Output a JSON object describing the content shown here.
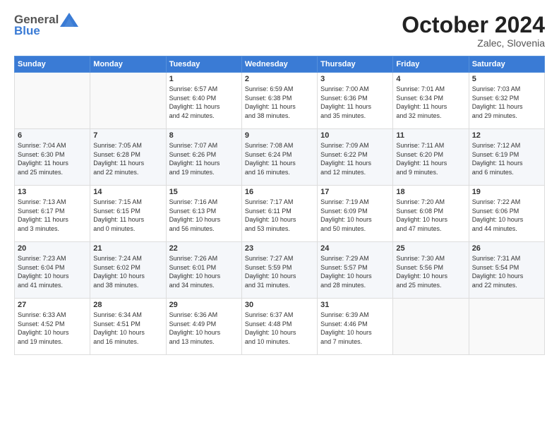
{
  "header": {
    "logo_general": "General",
    "logo_blue": "Blue",
    "month_year": "October 2024",
    "location": "Zalec, Slovenia"
  },
  "days_of_week": [
    "Sunday",
    "Monday",
    "Tuesday",
    "Wednesday",
    "Thursday",
    "Friday",
    "Saturday"
  ],
  "weeks": [
    [
      {
        "day": "",
        "info": ""
      },
      {
        "day": "",
        "info": ""
      },
      {
        "day": "1",
        "info": "Sunrise: 6:57 AM\nSunset: 6:40 PM\nDaylight: 11 hours\nand 42 minutes."
      },
      {
        "day": "2",
        "info": "Sunrise: 6:59 AM\nSunset: 6:38 PM\nDaylight: 11 hours\nand 38 minutes."
      },
      {
        "day": "3",
        "info": "Sunrise: 7:00 AM\nSunset: 6:36 PM\nDaylight: 11 hours\nand 35 minutes."
      },
      {
        "day": "4",
        "info": "Sunrise: 7:01 AM\nSunset: 6:34 PM\nDaylight: 11 hours\nand 32 minutes."
      },
      {
        "day": "5",
        "info": "Sunrise: 7:03 AM\nSunset: 6:32 PM\nDaylight: 11 hours\nand 29 minutes."
      }
    ],
    [
      {
        "day": "6",
        "info": "Sunrise: 7:04 AM\nSunset: 6:30 PM\nDaylight: 11 hours\nand 25 minutes."
      },
      {
        "day": "7",
        "info": "Sunrise: 7:05 AM\nSunset: 6:28 PM\nDaylight: 11 hours\nand 22 minutes."
      },
      {
        "day": "8",
        "info": "Sunrise: 7:07 AM\nSunset: 6:26 PM\nDaylight: 11 hours\nand 19 minutes."
      },
      {
        "day": "9",
        "info": "Sunrise: 7:08 AM\nSunset: 6:24 PM\nDaylight: 11 hours\nand 16 minutes."
      },
      {
        "day": "10",
        "info": "Sunrise: 7:09 AM\nSunset: 6:22 PM\nDaylight: 11 hours\nand 12 minutes."
      },
      {
        "day": "11",
        "info": "Sunrise: 7:11 AM\nSunset: 6:20 PM\nDaylight: 11 hours\nand 9 minutes."
      },
      {
        "day": "12",
        "info": "Sunrise: 7:12 AM\nSunset: 6:19 PM\nDaylight: 11 hours\nand 6 minutes."
      }
    ],
    [
      {
        "day": "13",
        "info": "Sunrise: 7:13 AM\nSunset: 6:17 PM\nDaylight: 11 hours\nand 3 minutes."
      },
      {
        "day": "14",
        "info": "Sunrise: 7:15 AM\nSunset: 6:15 PM\nDaylight: 11 hours\nand 0 minutes."
      },
      {
        "day": "15",
        "info": "Sunrise: 7:16 AM\nSunset: 6:13 PM\nDaylight: 10 hours\nand 56 minutes."
      },
      {
        "day": "16",
        "info": "Sunrise: 7:17 AM\nSunset: 6:11 PM\nDaylight: 10 hours\nand 53 minutes."
      },
      {
        "day": "17",
        "info": "Sunrise: 7:19 AM\nSunset: 6:09 PM\nDaylight: 10 hours\nand 50 minutes."
      },
      {
        "day": "18",
        "info": "Sunrise: 7:20 AM\nSunset: 6:08 PM\nDaylight: 10 hours\nand 47 minutes."
      },
      {
        "day": "19",
        "info": "Sunrise: 7:22 AM\nSunset: 6:06 PM\nDaylight: 10 hours\nand 44 minutes."
      }
    ],
    [
      {
        "day": "20",
        "info": "Sunrise: 7:23 AM\nSunset: 6:04 PM\nDaylight: 10 hours\nand 41 minutes."
      },
      {
        "day": "21",
        "info": "Sunrise: 7:24 AM\nSunset: 6:02 PM\nDaylight: 10 hours\nand 38 minutes."
      },
      {
        "day": "22",
        "info": "Sunrise: 7:26 AM\nSunset: 6:01 PM\nDaylight: 10 hours\nand 34 minutes."
      },
      {
        "day": "23",
        "info": "Sunrise: 7:27 AM\nSunset: 5:59 PM\nDaylight: 10 hours\nand 31 minutes."
      },
      {
        "day": "24",
        "info": "Sunrise: 7:29 AM\nSunset: 5:57 PM\nDaylight: 10 hours\nand 28 minutes."
      },
      {
        "day": "25",
        "info": "Sunrise: 7:30 AM\nSunset: 5:56 PM\nDaylight: 10 hours\nand 25 minutes."
      },
      {
        "day": "26",
        "info": "Sunrise: 7:31 AM\nSunset: 5:54 PM\nDaylight: 10 hours\nand 22 minutes."
      }
    ],
    [
      {
        "day": "27",
        "info": "Sunrise: 6:33 AM\nSunset: 4:52 PM\nDaylight: 10 hours\nand 19 minutes."
      },
      {
        "day": "28",
        "info": "Sunrise: 6:34 AM\nSunset: 4:51 PM\nDaylight: 10 hours\nand 16 minutes."
      },
      {
        "day": "29",
        "info": "Sunrise: 6:36 AM\nSunset: 4:49 PM\nDaylight: 10 hours\nand 13 minutes."
      },
      {
        "day": "30",
        "info": "Sunrise: 6:37 AM\nSunset: 4:48 PM\nDaylight: 10 hours\nand 10 minutes."
      },
      {
        "day": "31",
        "info": "Sunrise: 6:39 AM\nSunset: 4:46 PM\nDaylight: 10 hours\nand 7 minutes."
      },
      {
        "day": "",
        "info": ""
      },
      {
        "day": "",
        "info": ""
      }
    ]
  ]
}
